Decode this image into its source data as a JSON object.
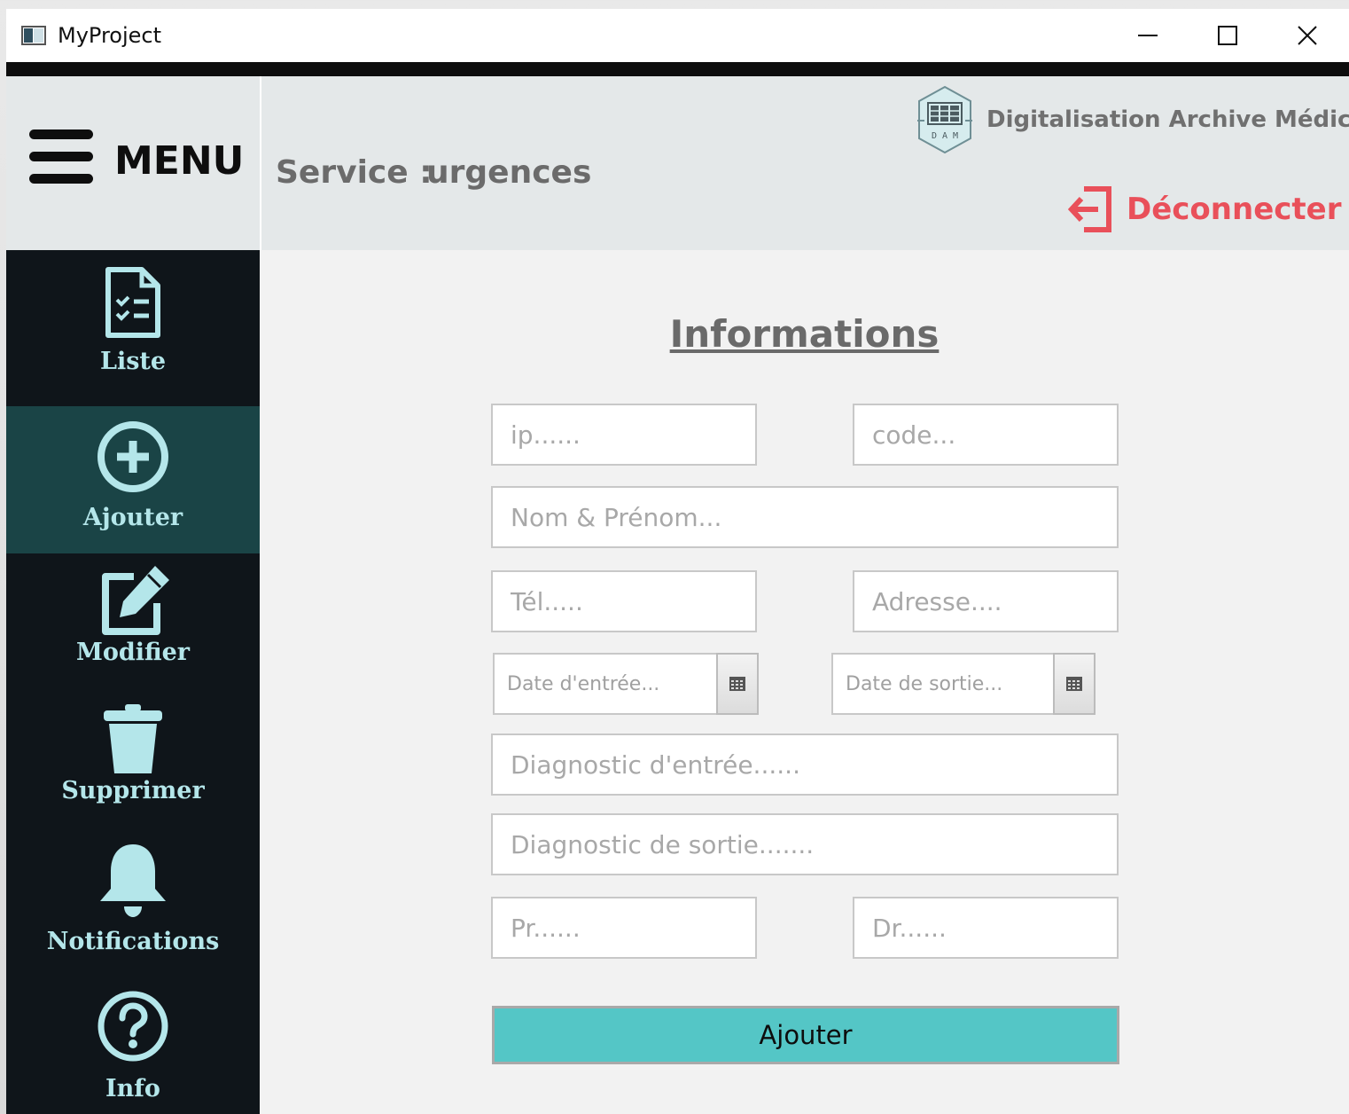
{
  "window": {
    "title": "MyProject"
  },
  "header": {
    "menu_label": "MENU",
    "service_label": "Service :",
    "service_value": "urgences",
    "brand_text": "Digitalisation Archive Médical",
    "logout_label": "Déconnecter",
    "logout_color": "#e9505a"
  },
  "sidebar": {
    "background": "#0f151a",
    "active_background": "#1a4446",
    "items": [
      {
        "label": "Liste",
        "icon": "checklist-document-icon",
        "active": false
      },
      {
        "label": "Ajouter",
        "icon": "plus-circle-icon",
        "active": true
      },
      {
        "label": "Modifier",
        "icon": "edit-icon",
        "active": false
      },
      {
        "label": "Supprimer",
        "icon": "trash-icon",
        "active": false
      },
      {
        "label": "Notifications",
        "icon": "bell-icon",
        "active": false
      },
      {
        "label": "Info",
        "icon": "question-circle-icon",
        "active": false
      }
    ]
  },
  "form": {
    "title": "Informations",
    "fields": {
      "ip": {
        "placeholder": "ip......",
        "value": ""
      },
      "code": {
        "placeholder": "code...",
        "value": ""
      },
      "name": {
        "placeholder": "Nom & Prénom...",
        "value": ""
      },
      "tel": {
        "placeholder": "Tél.....",
        "value": ""
      },
      "address": {
        "placeholder": "Adresse....",
        "value": ""
      },
      "date_in": {
        "placeholder": "Date d'entrée...",
        "value": ""
      },
      "date_out": {
        "placeholder": "Date de sortie...",
        "value": ""
      },
      "diag_in": {
        "placeholder": "Diagnostic d'entrée......",
        "value": ""
      },
      "diag_out": {
        "placeholder": "Diagnostic de sortie.......",
        "value": ""
      },
      "pr": {
        "placeholder": "Pr......",
        "value": ""
      },
      "dr": {
        "placeholder": "Dr......",
        "value": ""
      }
    },
    "submit_label": "Ajouter",
    "submit_color": "#54c6c6"
  }
}
